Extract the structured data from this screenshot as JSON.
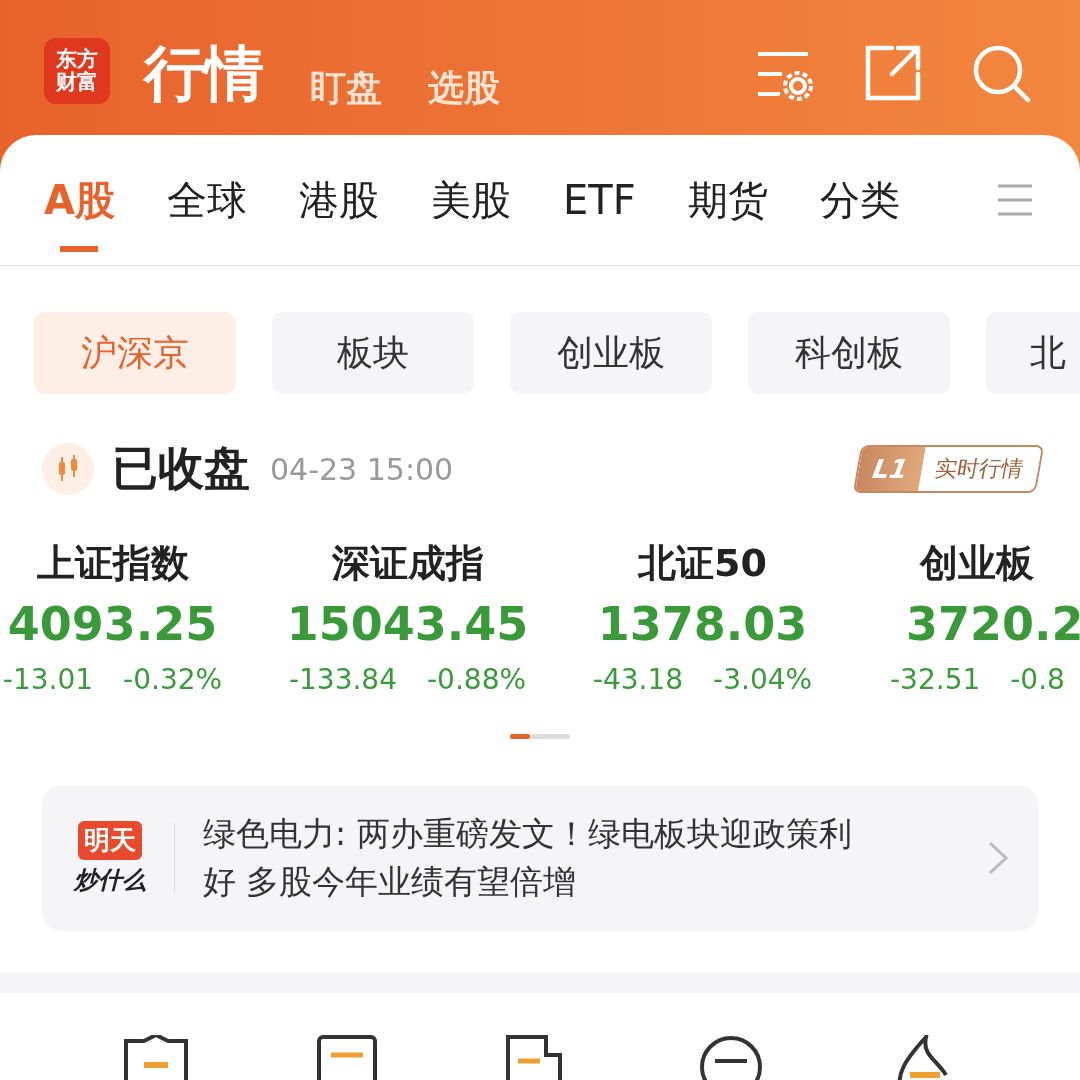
{
  "header": {
    "logo": [
      "东方",
      "财富"
    ],
    "title": "行情",
    "links": [
      "盯盘",
      "选股"
    ]
  },
  "tabs": [
    {
      "label": "A股",
      "selected": true
    },
    {
      "label": "全球",
      "selected": false
    },
    {
      "label": "港股",
      "selected": false
    },
    {
      "label": "美股",
      "selected": false
    },
    {
      "label": "ETF",
      "selected": false
    },
    {
      "label": "期货",
      "selected": false
    },
    {
      "label": "分类",
      "selected": false
    }
  ],
  "chips": [
    {
      "label": "沪深京",
      "selected": true
    },
    {
      "label": "板块",
      "selected": false
    },
    {
      "label": "创业板",
      "selected": false
    },
    {
      "label": "科创板",
      "selected": false
    },
    {
      "label": "北",
      "selected": false
    }
  ],
  "status": {
    "label": "已收盘",
    "time": "04-23 15:00",
    "badge_level": "L1",
    "badge_text": "实时行情"
  },
  "indices": [
    {
      "name": "上证指数",
      "value": "4093.25",
      "change": "-13.01",
      "percent": "-0.32%",
      "color": "#3a9a3a"
    },
    {
      "name": "深证成指",
      "value": "15043.45",
      "change": "-133.84",
      "percent": "-0.88%",
      "color": "#3a9a3a"
    },
    {
      "name": "北证50",
      "value": "1378.03",
      "change": "-43.18",
      "percent": "-3.04%",
      "color": "#3a9a3a"
    },
    {
      "name": "创业板",
      "value": "3720.2",
      "change": "-32.51",
      "percent": "-0.8",
      "color": "#3a9a3a"
    }
  ],
  "news": {
    "logo_top": "明天",
    "logo_bottom": "炒什么",
    "text": "绿色电力: 两办重磅发文！绿电板块迎政策利好 多股今年业绩有望倍增"
  }
}
